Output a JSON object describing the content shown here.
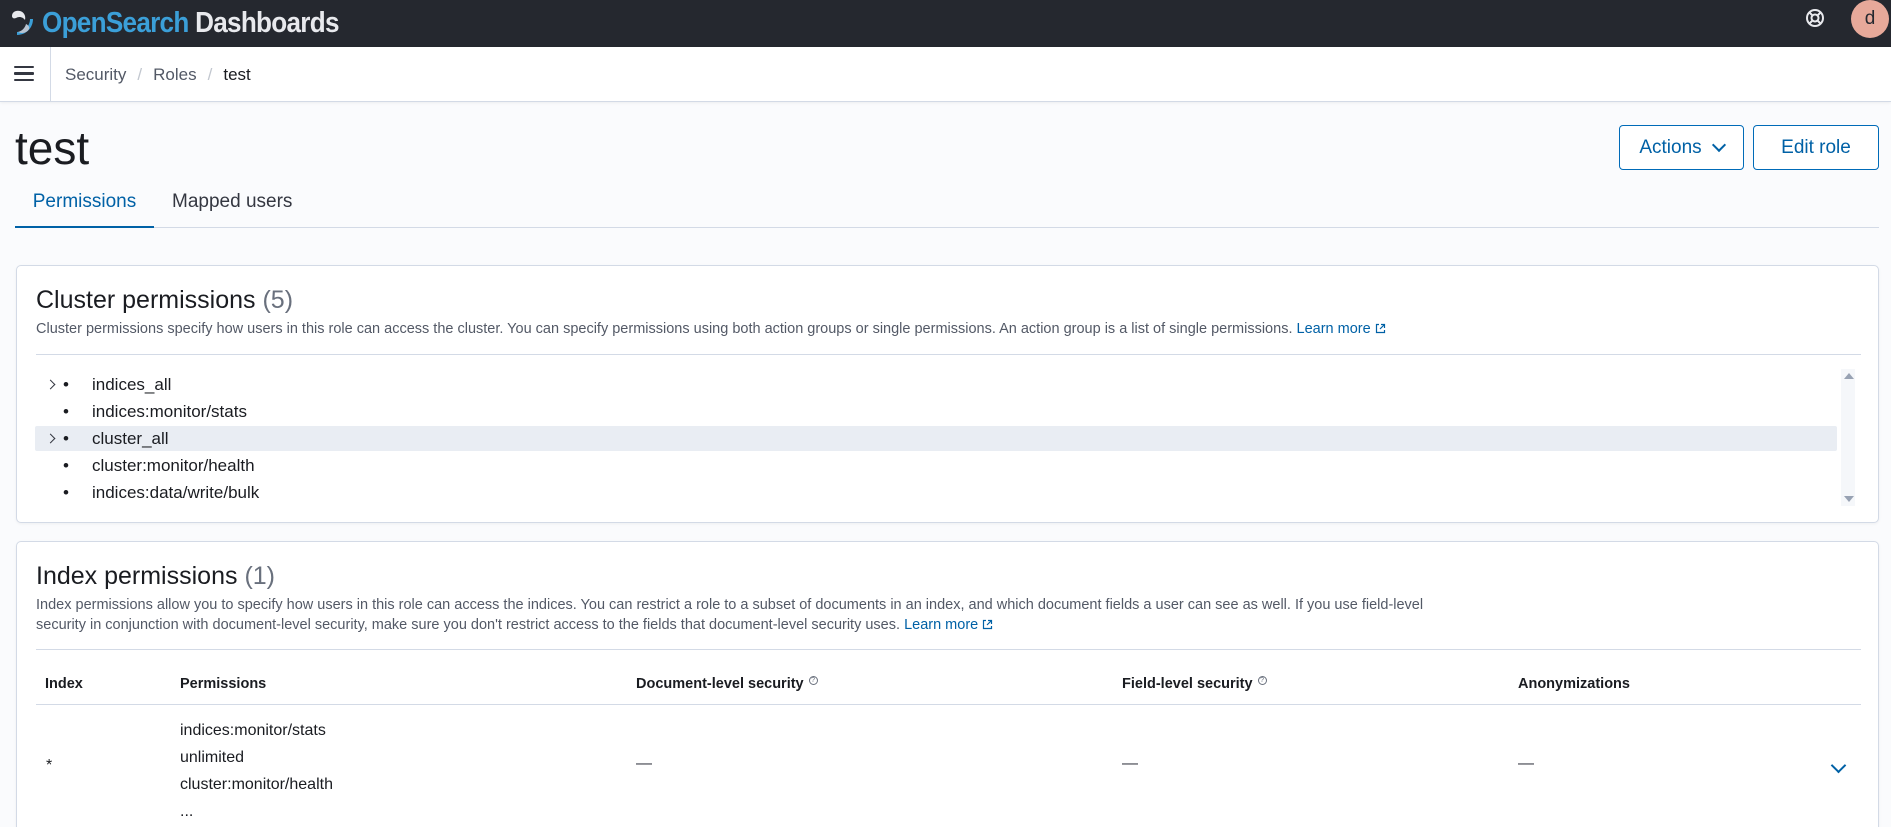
{
  "app": {
    "brand_open": "Open",
    "brand_search": "Search",
    "brand_dashboards": " Dashboards",
    "avatar_initial": "d"
  },
  "breadcrumbs": [
    "Security",
    "Roles",
    "test"
  ],
  "page": {
    "title": "test",
    "actions_label": "Actions",
    "edit_label": "Edit role"
  },
  "tabs": [
    {
      "label": "Permissions",
      "active": true
    },
    {
      "label": "Mapped users",
      "active": false
    }
  ],
  "cluster": {
    "title": "Cluster permissions",
    "count": "(5)",
    "description": "Cluster permissions specify how users in this role can access the cluster. You can specify permissions using both action groups or single permissions. An action group is a list of single permissions.",
    "learn_more": "Learn more",
    "items": [
      {
        "label": "indices_all",
        "expandable": true
      },
      {
        "label": "indices:monitor/stats",
        "expandable": false
      },
      {
        "label": "cluster_all",
        "expandable": true,
        "highlighted": true
      },
      {
        "label": "cluster:monitor/health",
        "expandable": false
      },
      {
        "label": "indices:data/write/bulk",
        "expandable": false
      }
    ]
  },
  "index": {
    "title": "Index permissions",
    "count": "(1)",
    "description_line1": "Index permissions allow you to specify how users in this role can access the indices. You can restrict a role to a subset of documents in an index, and which document fields a user can see as well. If you use field-level",
    "description_line2": "security in conjunction with document-level security, make sure you don't restrict access to the fields that document-level security uses.",
    "learn_more": "Learn more",
    "columns": [
      "Index",
      "Permissions",
      "Document-level security",
      "Field-level security",
      "Anonymizations"
    ],
    "rows": [
      {
        "index": "*",
        "permissions": [
          "indices:monitor/stats",
          "unlimited",
          "cluster:monitor/health",
          "..."
        ],
        "dls": "—",
        "fls": "—",
        "anonymizations": "—"
      }
    ]
  },
  "icons": {
    "help": "help-ring-icon",
    "menu": "hamburger-menu-icon",
    "external": "external-link-icon"
  },
  "colors": {
    "header_bg": "#25282f",
    "accent": "#0061a6",
    "avatar_bg": "#e7a99a",
    "logo_blue": "#3b9fd8"
  }
}
